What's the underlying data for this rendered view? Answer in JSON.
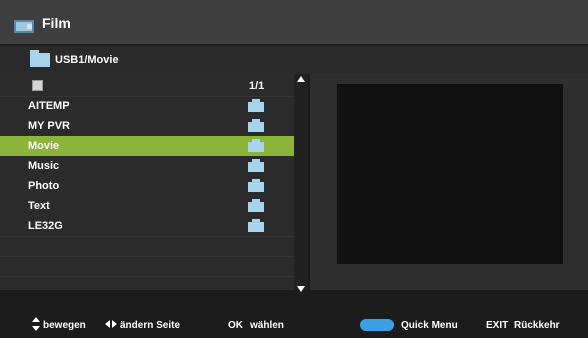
{
  "window": {
    "title": "Film"
  },
  "path": {
    "label": "USB1/Movie"
  },
  "list": {
    "page_indicator": "1/1",
    "items": [
      {
        "label": "AITEMP",
        "icon": "folder-icon"
      },
      {
        "label": "MY PVR",
        "icon": "folder-icon"
      },
      {
        "label": "Movie",
        "icon": "folder-icon",
        "selected": true
      },
      {
        "label": "Music",
        "icon": "folder-icon"
      },
      {
        "label": "Photo",
        "icon": "folder-icon"
      },
      {
        "label": "Text",
        "icon": "folder-icon"
      },
      {
        "label": "LE32G",
        "icon": "folder-icon"
      }
    ]
  },
  "footer": {
    "move": "bewegen",
    "change_page": "ändern Seite",
    "ok_key": "OK",
    "ok_action": "wählen",
    "quick_menu": "Quick Menu",
    "exit_key": "EXIT",
    "exit_action": "Rückkehr"
  },
  "colors": {
    "selection": "#8cb33a",
    "folder": "#a9d3ec",
    "quick_menu_button": "#3aa0e0"
  }
}
